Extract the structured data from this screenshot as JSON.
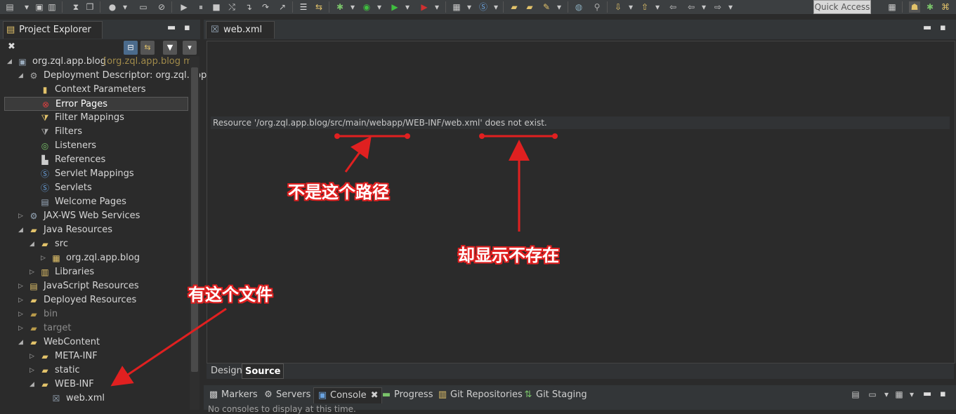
{
  "toolbar": {
    "quick_access": "Quick Access"
  },
  "project_explorer": {
    "tab_label": "Project Explorer",
    "close": "✖",
    "minimize": "▬",
    "maximize": "▪",
    "tree": [
      {
        "label": "org.zql.app.blog",
        "decoration": "[org.zql.app.blog ma"
      },
      {
        "label": "Deployment Descriptor: org.zql.app"
      },
      {
        "label": "Context Parameters"
      },
      {
        "label": "Error Pages"
      },
      {
        "label": "Filter Mappings"
      },
      {
        "label": "Filters"
      },
      {
        "label": "Listeners"
      },
      {
        "label": "References"
      },
      {
        "label": "Servlet Mappings"
      },
      {
        "label": "Servlets"
      },
      {
        "label": "Welcome Pages"
      },
      {
        "label": "JAX-WS Web Services"
      },
      {
        "label": "Java Resources"
      },
      {
        "label": "src"
      },
      {
        "label": "org.zql.app.blog"
      },
      {
        "label": "Libraries"
      },
      {
        "label": "JavaScript Resources"
      },
      {
        "label": "Deployed Resources"
      },
      {
        "label": "bin"
      },
      {
        "label": "target"
      },
      {
        "label": "WebContent"
      },
      {
        "label": "META-INF"
      },
      {
        "label": "static"
      },
      {
        "label": "WEB-INF"
      },
      {
        "label": "web.xml"
      }
    ]
  },
  "editor": {
    "tab_label": "web.xml",
    "close": "✖",
    "message": "Resource '/org.zql.app.blog/src/main/webapp/WEB-INF/web.xml' does not exist.",
    "tabs": [
      "Design",
      "Source"
    ]
  },
  "bottom_panel": {
    "tabs": [
      "Markers",
      "Servers",
      "Console",
      "Progress",
      "Git Repositories",
      "Git Staging"
    ],
    "console_close": "✖",
    "console_text": "No consoles to display at this time."
  },
  "annotations": {
    "not_this_path": "不是这个路径",
    "shows_not_exist": "却显示不存在",
    "file_exists": "有这个文件",
    "color": "#e02020"
  }
}
